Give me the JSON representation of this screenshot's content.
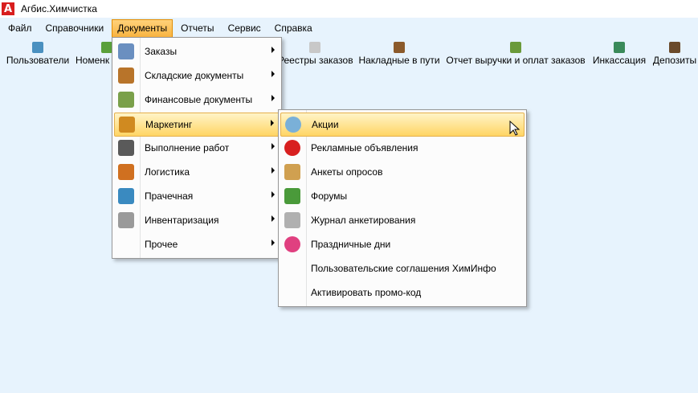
{
  "window": {
    "title": "Агбис.Химчистка"
  },
  "menubar": {
    "items": [
      "Файл",
      "Справочники",
      "Документы",
      "Отчеты",
      "Сервис",
      "Справка"
    ]
  },
  "toolbar": {
    "items": [
      {
        "label": "Пользователи",
        "color": "#4a90c0"
      },
      {
        "label": "Номенк",
        "color": "#5aa03a"
      },
      {
        "label": "Реестры заказов",
        "color": "#c8c8c8"
      },
      {
        "label": "Накладные в пути",
        "color": "#8b5a2b"
      },
      {
        "label": "Отчет выручки и оплат заказов",
        "color": "#6a9a3a"
      },
      {
        "label": "Инкассация",
        "color": "#3a8a5a"
      },
      {
        "label": "Депозиты",
        "color": "#6a4a2a"
      }
    ]
  },
  "documents_menu": {
    "items": [
      {
        "label": "Заказы",
        "icon": "orders-icon",
        "color": "#6a8fc0"
      },
      {
        "label": "Складские документы",
        "icon": "warehouse-icon",
        "color": "#b8742a"
      },
      {
        "label": "Финансовые документы",
        "icon": "money-icon",
        "color": "#7aa04a"
      },
      {
        "label": "Маркетинг",
        "icon": "marketing-icon",
        "color": "#d08a20"
      },
      {
        "label": "Выполнение работ",
        "icon": "tasks-icon",
        "color": "#5a5a5a"
      },
      {
        "label": "Логистика",
        "icon": "truck-icon",
        "color": "#d07020"
      },
      {
        "label": "Прачечная",
        "icon": "basket-icon",
        "color": "#3a8ac0"
      },
      {
        "label": "Инвентаризация",
        "icon": "magnifier-icon",
        "color": "#9a9a9a"
      },
      {
        "label": "Прочее",
        "icon": "",
        "color": ""
      }
    ]
  },
  "marketing_menu": {
    "items": [
      {
        "label": "Акции",
        "icon": "sale-icon",
        "color": "#7ab0d8"
      },
      {
        "label": "Рекламные объявления",
        "icon": "adv-icon",
        "color": "#d82020"
      },
      {
        "label": "Анкеты опросов",
        "icon": "clipboard-icon",
        "color": "#d0a050"
      },
      {
        "label": "Форумы",
        "icon": "forum-icon",
        "color": "#4a9a3a"
      },
      {
        "label": "Журнал анкетирования",
        "icon": "journal-icon",
        "color": "#b0b0b0"
      },
      {
        "label": "Праздничные дни",
        "icon": "balloons-icon",
        "color": "#e04080"
      },
      {
        "label": "Пользовательские соглашения ХимИнфо",
        "icon": "",
        "color": ""
      },
      {
        "label": "Активировать промо-код",
        "icon": "",
        "color": ""
      }
    ]
  }
}
